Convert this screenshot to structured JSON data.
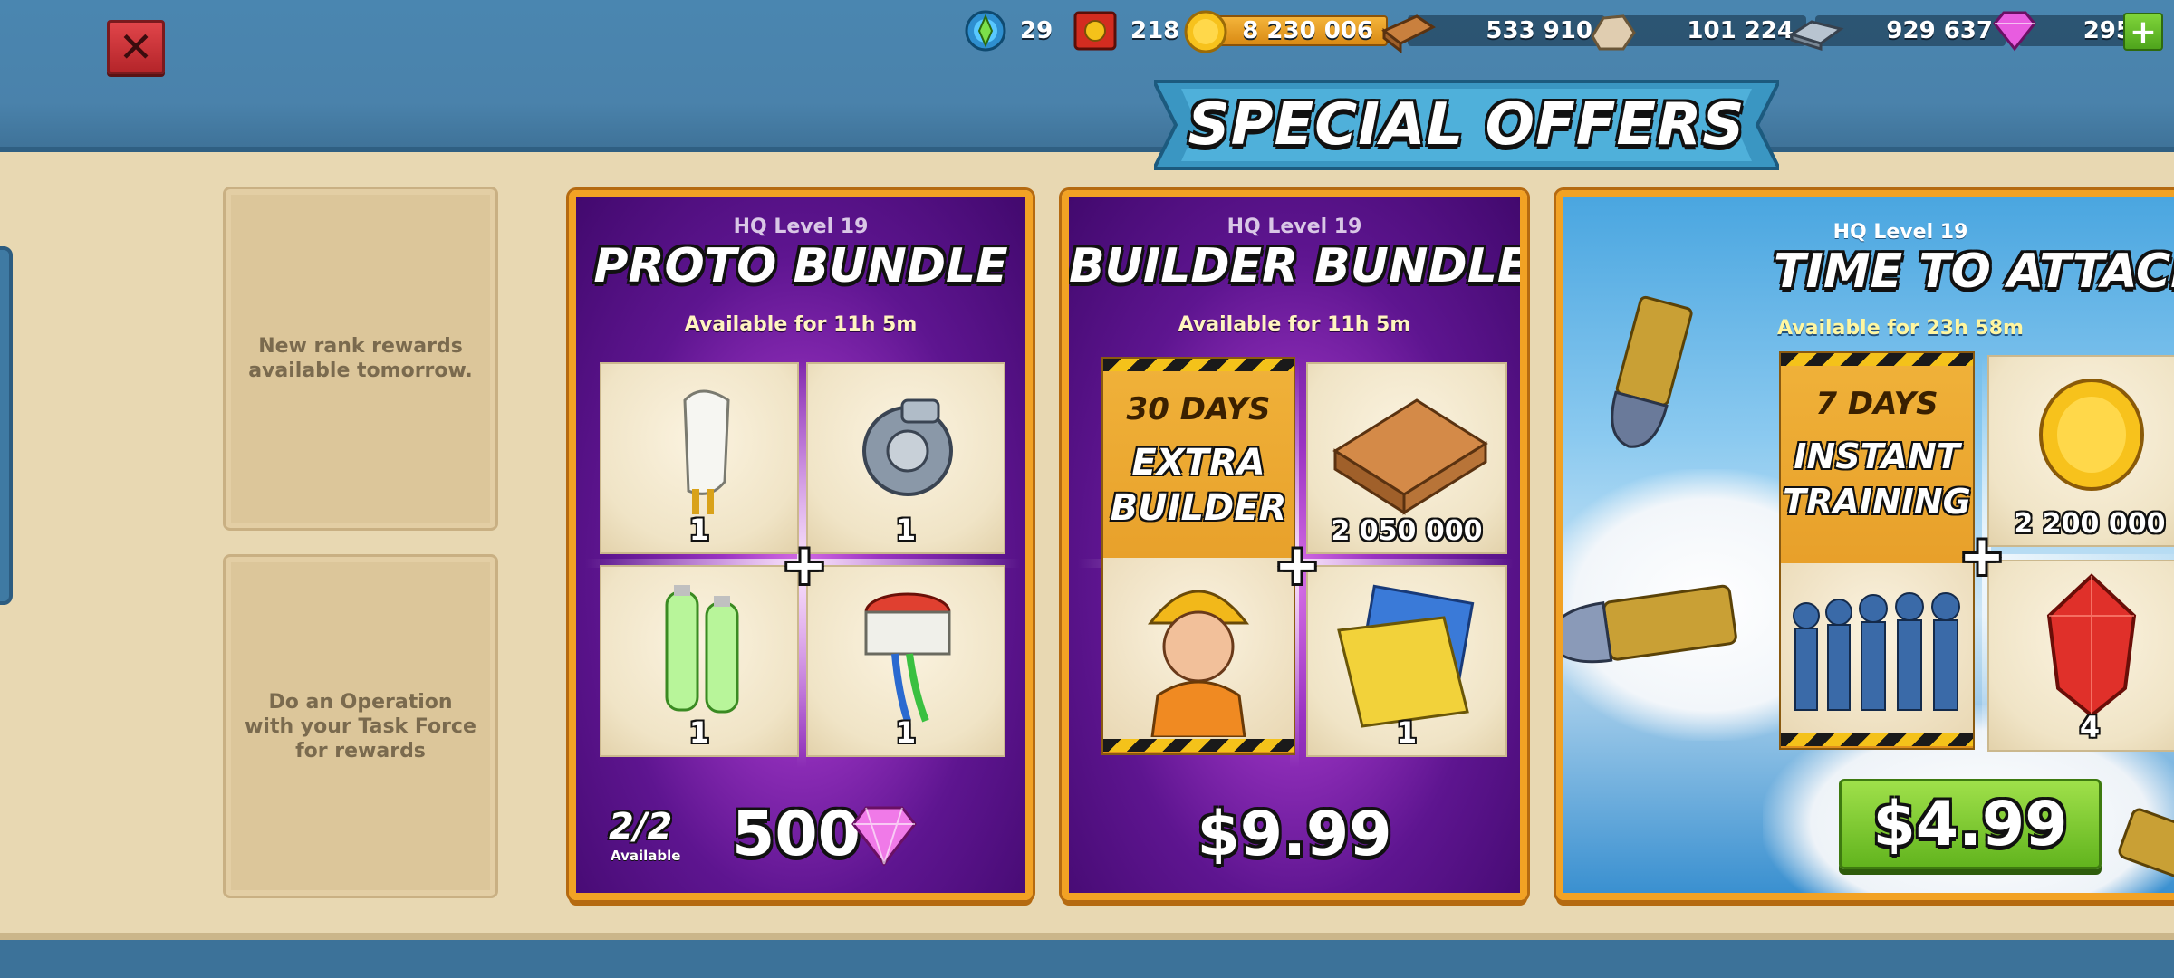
{
  "topbar": {
    "resources": [
      {
        "name": "intel",
        "value": "29"
      },
      {
        "name": "medals",
        "value": "218"
      },
      {
        "name": "gold",
        "value": "8 230 006"
      },
      {
        "name": "wood",
        "value": "533 910"
      },
      {
        "name": "stone",
        "value": "101 224"
      },
      {
        "name": "iron",
        "value": "929 637"
      },
      {
        "name": "diamonds",
        "value": "295"
      }
    ],
    "add_label": "+"
  },
  "banner": {
    "title": "SPECIAL OFFERS"
  },
  "rank_rewards": {
    "box1": "New rank rewards available tomorrow.",
    "box2": "Do an Operation with your Task Force for rewards"
  },
  "offers": [
    {
      "hq": "HQ Level 19",
      "title": "PROTO BUNDLE",
      "availability": "Available for 11h 5m",
      "items": [
        {
          "icon": "prototype-part-bottle-icon",
          "count": "1"
        },
        {
          "icon": "prototype-part-gear-icon",
          "count": "1"
        },
        {
          "icon": "prototype-part-battery-icon",
          "count": "1"
        },
        {
          "icon": "prototype-part-cable-icon",
          "count": "1"
        }
      ],
      "stock": "2/2",
      "stock_label": "Available",
      "price": "500",
      "price_icon": "diamond-icon"
    },
    {
      "hq": "HQ Level 19",
      "title": "BUILDER BUNDLE",
      "availability": "Available for 11h 5m",
      "boost": {
        "line1": "30 DAYS",
        "line2": "EXTRA",
        "line3": "BUILDER"
      },
      "items": [
        {
          "icon": "wood-icon",
          "count": "2 050 000"
        },
        {
          "icon": "builder-portrait-icon",
          "count": ""
        },
        {
          "icon": "blueprint-folder-icon",
          "count": "1"
        }
      ],
      "price": "$9.99"
    },
    {
      "hq": "HQ Level 19",
      "title": "TIME TO ATTACK",
      "availability": "Available for 23h 58m",
      "boost": {
        "line1": "7 DAYS",
        "line2": "INSTANT",
        "line3": "TRAINING"
      },
      "items": [
        {
          "icon": "gold-coin-icon",
          "count": "2 200 000"
        },
        {
          "icon": "riflemen-troops-icon",
          "count": ""
        },
        {
          "icon": "red-crystal-icon",
          "count": "4"
        }
      ],
      "price": "$4.99"
    }
  ],
  "colors": {
    "gold_border": "#f2a224",
    "panel": "#e8d8b2",
    "sky_blue": "#3c7299",
    "buy_green": "#7ccb34"
  }
}
